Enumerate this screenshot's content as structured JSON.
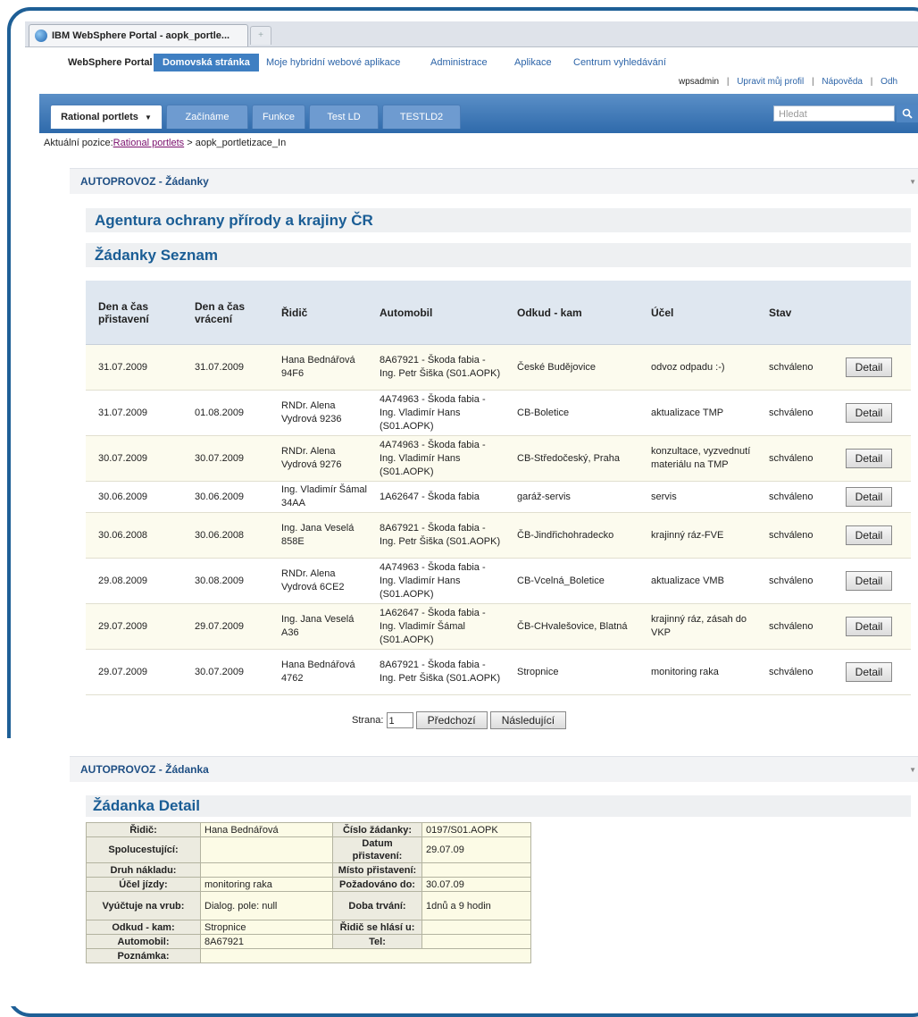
{
  "browser": {
    "tab_title": "IBM WebSphere Portal - aopk_portle...",
    "new_tab_glyph": "+"
  },
  "topnav": {
    "brand": "WebSphere Portal",
    "items": [
      "Domovská stránka",
      "Moje hybridní webové aplikace",
      "Administrace",
      "Aplikace",
      "Centrum vyhledávání"
    ]
  },
  "user": {
    "name": "wpsadmin",
    "links": [
      "Upravit můj profil",
      "Nápověda",
      "Odh"
    ]
  },
  "tabs": [
    "Rational portlets",
    "Začínáme",
    "Funkce",
    "Test LD",
    "TESTLD2"
  ],
  "tab_dropdown_glyph": "▼",
  "search": {
    "placeholder": "Hledat",
    "icon": "search-icon"
  },
  "breadcrumb": {
    "prefix": "Aktuální pozice:",
    "link": "Rational portlets",
    "sep": " > ",
    "current": "aopk_portletizace_In"
  },
  "portlet1": {
    "title": "AUTOPROVOZ - Žádanky",
    "org_title": "Agentura ochrany přírody a krajiny ČR",
    "list_title": "Žádanky Seznam",
    "columns": [
      "Den a čas přistavení",
      "Den a čas vrácení",
      "Řidič",
      "Automobil",
      "Odkud - kam",
      "Účel",
      "Stav",
      ""
    ],
    "rows": [
      {
        "from": "31.07.2009",
        "to": "31.07.2009",
        "driver": "Hana Bednářová 94F6",
        "car": "8A67921 - Škoda fabia - Ing. Petr Šiška (S01.AOPK)",
        "route": "České Budějovice",
        "purpose": "odvoz odpadu :-)",
        "status": "schváleno"
      },
      {
        "from": "31.07.2009",
        "to": "01.08.2009",
        "driver": "RNDr. Alena Vydrová 9236",
        "car": "4A74963 - Škoda fabia - Ing. Vladimír Hans (S01.AOPK)",
        "route": "CB-Boletice",
        "purpose": "aktualizace TMP",
        "status": "schváleno"
      },
      {
        "from": "30.07.2009",
        "to": "30.07.2009",
        "driver": "RNDr. Alena Vydrová 9276",
        "car": "4A74963 - Škoda fabia - Ing. Vladimír Hans (S01.AOPK)",
        "route": "CB-Středočeský, Praha",
        "purpose": "konzultace, vyzvednutí materiálu na TMP",
        "status": "schváleno"
      },
      {
        "from": "30.06.2009",
        "to": "30.06.2009",
        "driver": "Ing. Vladimír Šámal 34AA",
        "car": "1A62647 - Škoda fabia",
        "route": "garáž-servis",
        "purpose": "servis",
        "status": "schváleno"
      },
      {
        "from": "30.06.2008",
        "to": "30.06.2008",
        "driver": "Ing. Jana Veselá 858E",
        "car": "8A67921 - Škoda fabia - Ing. Petr Šiška (S01.AOPK)",
        "route": "ČB-Jindřichohradecko",
        "purpose": "krajinný ráz-FVE",
        "status": "schváleno"
      },
      {
        "from": "29.08.2009",
        "to": "30.08.2009",
        "driver": "RNDr. Alena Vydrová 6CE2",
        "car": "4A74963 - Škoda fabia - Ing. Vladimír Hans (S01.AOPK)",
        "route": "CB-Vcelná_Boletice",
        "purpose": "aktualizace VMB",
        "status": "schváleno"
      },
      {
        "from": "29.07.2009",
        "to": "29.07.2009",
        "driver": "Ing. Jana Veselá A36",
        "car": "1A62647 - Škoda fabia - Ing. Vladimír Šámal (S01.AOPK)",
        "route": "ČB-CHvalešovice, Blatná",
        "purpose": "krajinný ráz, zásah do VKP",
        "status": "schváleno"
      },
      {
        "from": "29.07.2009",
        "to": "30.07.2009",
        "driver": "Hana Bednářová 4762",
        "car": "8A67921 - Škoda fabia - Ing. Petr Šiška (S01.AOPK)",
        "route": "Stropnice",
        "purpose": "monitoring raka",
        "status": "schváleno"
      }
    ],
    "detail_button": "Detail",
    "pager": {
      "label": "Strana:",
      "page": "1",
      "prev": "Předchozí",
      "next": "Následující"
    }
  },
  "portlet2": {
    "title": "AUTOPROVOZ - Žádanka",
    "detail_title": "Žádanka Detail",
    "rows": [
      {
        "l1": "Řidič:",
        "v1": "Hana Bednářová",
        "l2": "Číslo žádanky:",
        "v2": "0197/S01.AOPK"
      },
      {
        "l1": "Spolucestující:",
        "v1": "",
        "l2": "Datum přistavení:",
        "v2": "29.07.09"
      },
      {
        "l1": "Druh nákladu:",
        "v1": "",
        "l2": "Místo přistavení:",
        "v2": ""
      },
      {
        "l1": "Účel jízdy:",
        "v1": "monitoring raka",
        "l2": "Požadováno do:",
        "v2": "30.07.09"
      },
      {
        "l1": "Vyúčtuje na vrub:",
        "v1": "Dialog. pole: null",
        "l2": "Doba trvání:",
        "v2": "1dnů a 9 hodin"
      },
      {
        "l1": "Odkud - kam:",
        "v1": "Stropnice",
        "l2": "Řidič se hlásí u:",
        "v2": ""
      },
      {
        "l1": "Automobil:",
        "v1": "8A67921",
        "l2": "Tel:",
        "v2": ""
      }
    ],
    "note_label": "Poznámka:",
    "note_value": ""
  }
}
